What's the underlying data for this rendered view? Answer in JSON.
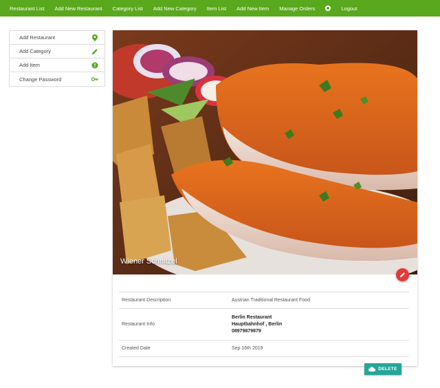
{
  "nav": {
    "items": [
      {
        "label": "Restaurant List"
      },
      {
        "label": "Add New Restaurant"
      },
      {
        "label": "Category List"
      },
      {
        "label": "Add New Category"
      },
      {
        "label": "Item List"
      },
      {
        "label": "Add New Item"
      },
      {
        "label": "Manage Orders"
      }
    ],
    "globe_icon": "globe-icon",
    "logout_label": "Logout"
  },
  "sidebar": {
    "items": [
      {
        "label": "Add Restaurant",
        "icon": "map-marker-icon"
      },
      {
        "label": "Add Category",
        "icon": "pencil-icon"
      },
      {
        "label": "Add Item",
        "icon": "info-icon"
      },
      {
        "label": "Change Password",
        "icon": "key-icon"
      }
    ]
  },
  "card": {
    "title": "Wiener Schnitzel",
    "edit_icon": "pencil-icon",
    "details": {
      "description_label": "Restaurant Description",
      "description_value": "Austrian Traditional Restaurant Food",
      "info_label": "Restaurant Info",
      "info_name": "Berlin Restaurant",
      "info_address": "Hauptbahnhof , Berlin",
      "info_phone": "08979879879",
      "created_label": "Created Date",
      "created_value": "Sep 16th 2019"
    },
    "delete_label": "DELETE",
    "delete_icon": "cloud-icon"
  },
  "colors": {
    "navbar": "#5aa81e",
    "icon_green": "#5aa81e",
    "fab_red": "#e53935",
    "delete_teal": "#26a69a"
  }
}
